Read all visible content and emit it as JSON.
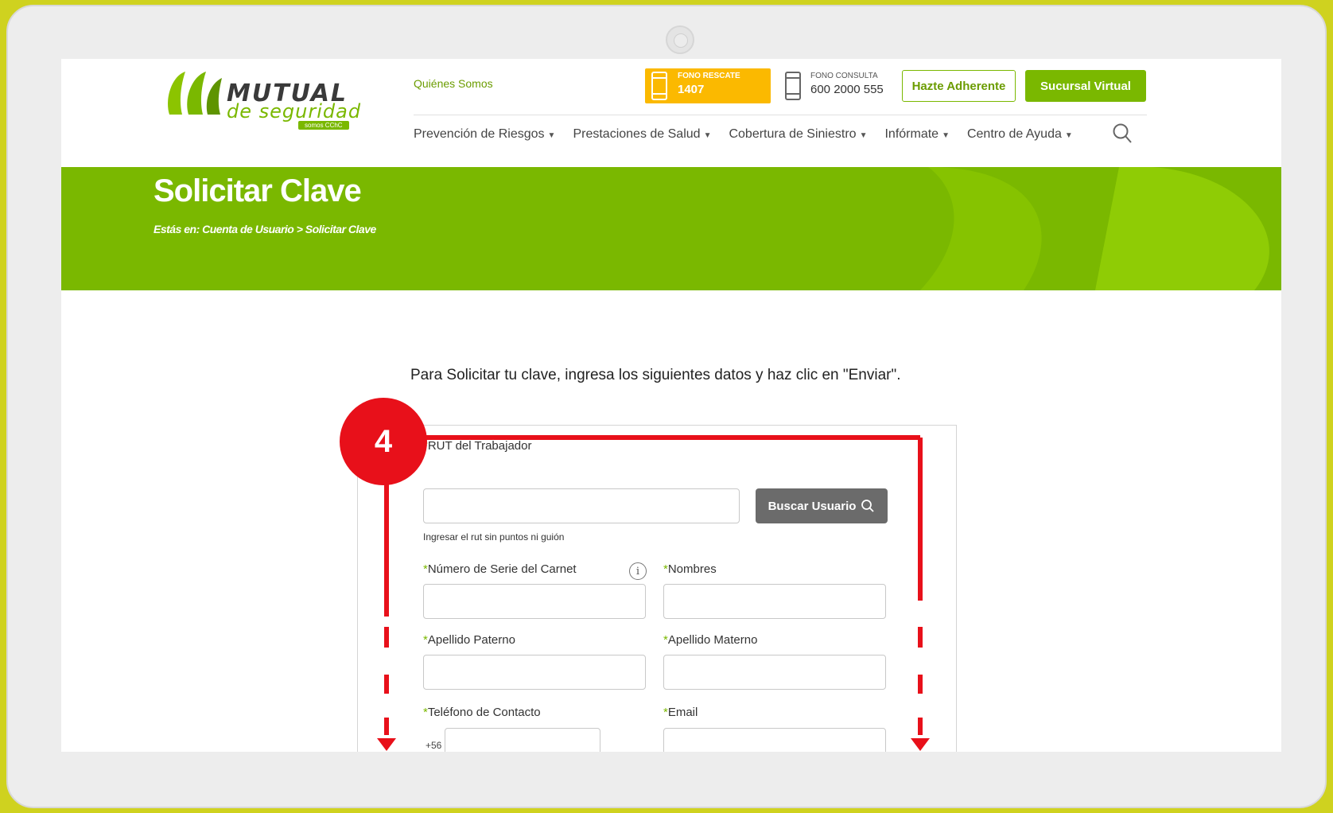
{
  "header": {
    "logo": {
      "line1": "MUTUAL",
      "line2": "de seguridad",
      "tag": "somos CChC"
    },
    "top_link": "Quiénes Somos",
    "fono_rescate": {
      "label": "FONO RESCATE",
      "number": "1407"
    },
    "fono_consulta": {
      "label": "FONO CONSULTA",
      "number": "600 2000 555"
    },
    "adherente_button": "Hazte Adherente",
    "sucursal_button": "Sucursal Virtual",
    "nav": [
      {
        "label": "Prevención de Riesgos"
      },
      {
        "label": "Prestaciones de Salud"
      },
      {
        "label": "Cobertura de Siniestro"
      },
      {
        "label": "Infórmate"
      },
      {
        "label": "Centro de Ayuda"
      }
    ]
  },
  "banner": {
    "title": "Solicitar Clave",
    "breadcrumb": "Estás en: Cuenta de Usuario > Solicitar Clave"
  },
  "form": {
    "intro": "Para Solicitar tu clave, ingresa los siguientes datos y haz clic en \"Enviar\".",
    "required_mark": "*",
    "rut_label": "RUT del Trabajador",
    "rut_help": "Ingresar el rut sin puntos ni guión",
    "buscar_button": "Buscar Usuario",
    "serie_label": "Número de Serie del Carnet",
    "info_glyph": "i",
    "nombres_label": "Nombres",
    "paterno_label": "Apellido Paterno",
    "materno_label": "Apellido Materno",
    "telefono_label": "Teléfono de Contacto",
    "telefono_prefix": "+56",
    "email_label": "Email"
  },
  "annotation": {
    "step": "4",
    "color": "#e8101a"
  },
  "colors": {
    "brand_green": "#7ab800",
    "rescate_yellow": "#fbb900",
    "frame": "#cfd21f"
  }
}
